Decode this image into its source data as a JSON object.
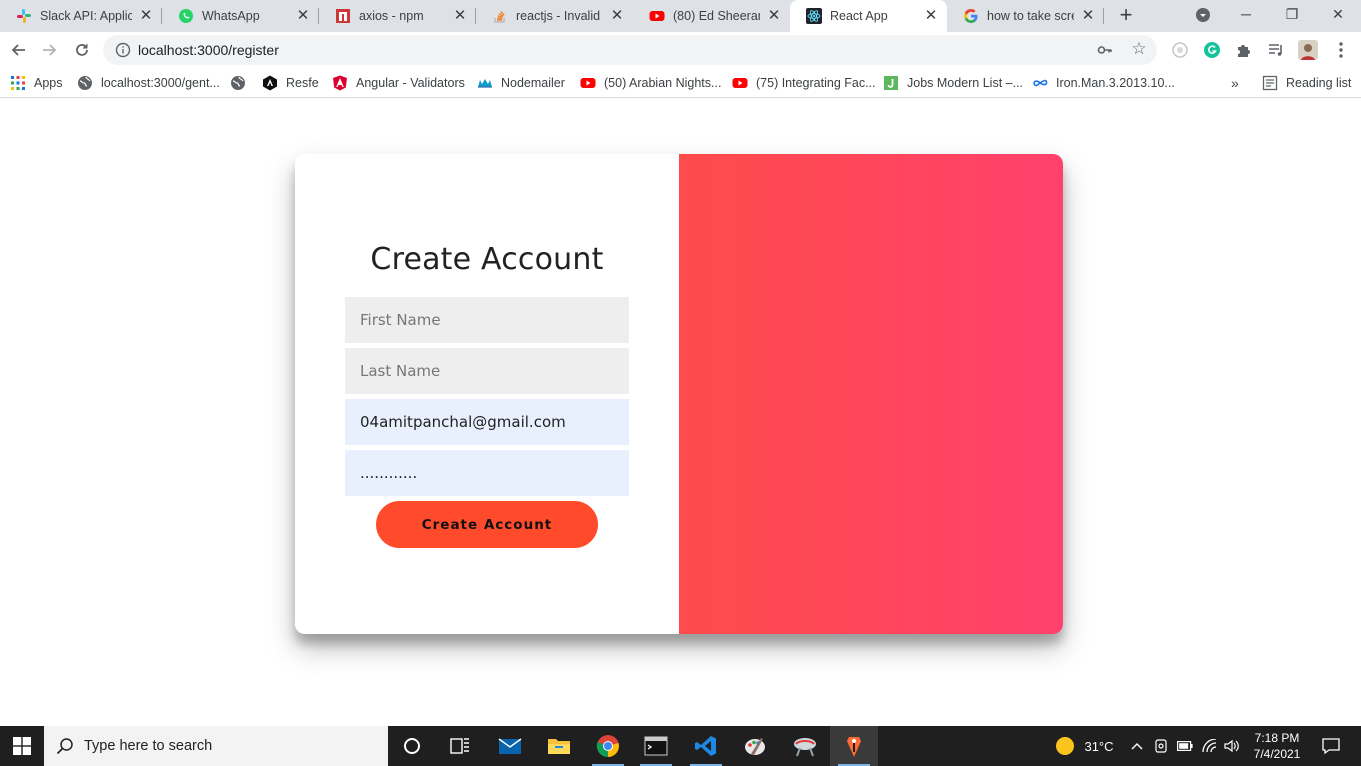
{
  "browser": {
    "tabs": [
      {
        "title": "Slack API: Applica",
        "icon": "slack-icon"
      },
      {
        "title": "WhatsApp",
        "icon": "whatsapp-icon"
      },
      {
        "title": "axios - npm",
        "icon": "npm-icon"
      },
      {
        "title": "reactjs - Invalid H",
        "icon": "stackoverflow-icon"
      },
      {
        "title": "(80) Ed Sheeran -",
        "icon": "youtube-icon"
      },
      {
        "title": "React App",
        "icon": "react-icon",
        "active": true
      },
      {
        "title": "how to take scree",
        "icon": "google-icon"
      }
    ],
    "url": "localhost:3000/register",
    "bookmarks": [
      {
        "label": "Apps",
        "icon": "apps-grid-icon"
      },
      {
        "label": "localhost:3000/gent...",
        "icon": "globe-icon"
      },
      {
        "label": "",
        "icon": "globe-icon"
      },
      {
        "label": "Resfe",
        "icon": "resfe-icon"
      },
      {
        "label": "Angular - Validators",
        "icon": "angular-icon"
      },
      {
        "label": "Nodemailer",
        "icon": "nodemailer-icon"
      },
      {
        "label": "(50) Arabian Nights...",
        "icon": "youtube-icon"
      },
      {
        "label": "(75) Integrating Fac...",
        "icon": "youtube-icon"
      },
      {
        "label": "Jobs Modern List –...",
        "icon": "jobs-icon"
      },
      {
        "label": "Iron.Man.3.2013.10...",
        "icon": "infinity-icon"
      }
    ],
    "overflow_label": "»",
    "reading_list_label": "Reading list"
  },
  "page": {
    "title": "Create Account",
    "first_name_placeholder": "First Name",
    "last_name_placeholder": "Last Name",
    "email_value": "04amitpanchal@gmail.com",
    "password_value": "............",
    "submit_label": "Create Account",
    "accent_color": "#ff4b2b",
    "gradient_colors": [
      "#ff4b4b",
      "#ff416c"
    ]
  },
  "taskbar": {
    "search_placeholder": "Type here to search",
    "weather": "31°C",
    "time": "7:18 PM",
    "date": "7/4/2021"
  }
}
